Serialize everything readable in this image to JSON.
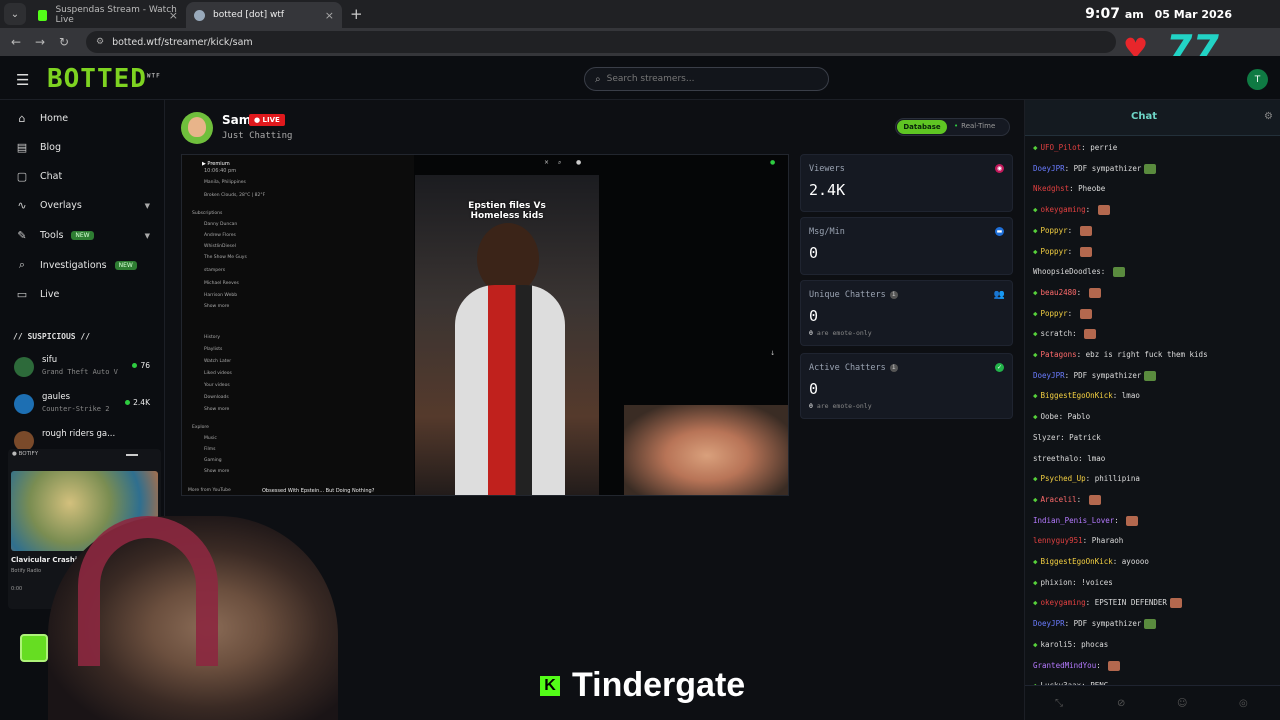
{
  "browser": {
    "tabs": [
      {
        "label": "Suspendas Stream - Watch Live",
        "active": false
      },
      {
        "label": "botted [dot] wtf",
        "active": true
      }
    ],
    "url": "botted.wtf/streamer/kick/sam",
    "clock_time": "9:07",
    "clock_ampm": "am",
    "clock_date": "05 Mar 2026",
    "overlay_number": "77"
  },
  "header": {
    "logo": "BOTTED",
    "logo_sup": "WTF",
    "search_placeholder": "Search streamers...",
    "user_initial": "T"
  },
  "sidebar": {
    "items": [
      {
        "label": "Home",
        "icon": "home-icon"
      },
      {
        "label": "Blog",
        "icon": "blog-icon"
      },
      {
        "label": "Chat",
        "icon": "chat-icon"
      },
      {
        "label": "Overlays",
        "icon": "overlays-icon"
      },
      {
        "label": "Tools",
        "icon": "tools-icon",
        "badge": "NEW"
      },
      {
        "label": "Investigations",
        "icon": "investigations-icon",
        "badge": "NEW"
      },
      {
        "label": "Live",
        "icon": "live-icon"
      }
    ],
    "suspicious_title": "// SUSPICIOUS //",
    "suspicious": [
      {
        "name": "sifu",
        "game": "Grand Theft Auto V",
        "viewers": "76"
      },
      {
        "name": "gaules",
        "game": "Counter-Strike 2",
        "viewers": "2.4K"
      },
      {
        "name": "rough riders ga...",
        "game": "",
        "viewers": ""
      }
    ]
  },
  "botify": {
    "title": "BOTIFY",
    "song": "Clavicular Crashin'",
    "artist": "Botify Radio",
    "time": "0:00"
  },
  "streamer": {
    "name": "Sam",
    "live_label": "LIVE",
    "category": "Just Chatting",
    "toggle_on": "Database",
    "toggle_off": "Real-Time"
  },
  "video": {
    "caption": "Epstien files Vs Homeless kids",
    "yt_time": "10:06:40 pm",
    "yt_location": "Manila, Philippines",
    "yt_weather": "Broken Clouds, 28°C | 82°F",
    "yt_footer": "Obsessed With Epstein... But Doing Nothing?",
    "yt_more": "More from YouTube",
    "yt_sidebar": [
      "Subscriptions",
      "Danny Duncan",
      "Andrew Flores",
      "WhistlinDiesel",
      "The Show Me Guys",
      "stampers",
      "Michael Reeves",
      "Harrison Webb",
      "Show more",
      "History",
      "Playlists",
      "Watch Later",
      "Liked videos",
      "Your videos",
      "Downloads",
      "Show more",
      "Explore",
      "Music",
      "Films",
      "Gaming",
      "Show more"
    ]
  },
  "stats": {
    "viewers_label": "Viewers",
    "viewers_value": "2.4K",
    "msgmin_label": "Msg/Min",
    "msgmin_value": "0",
    "unique_label": "Unique Chatters",
    "unique_value": "0",
    "unique_sub_num": "0",
    "unique_sub": "are emote-only",
    "active_label": "Active Chatters",
    "active_value": "0",
    "active_sub_num": "0",
    "active_sub": "are emote-only"
  },
  "overlay_caption": "Tindergate",
  "chat": {
    "title": "Chat",
    "messages": [
      {
        "user": "UFO_Pilot",
        "text": "perrie",
        "color": "#e04040",
        "badge": true
      },
      {
        "user": "DoeyJPR",
        "text": "PDF sympathizer",
        "color": "#6a7cff",
        "badge": false,
        "emote": "green"
      },
      {
        "user": "Nkedghst",
        "text": "Pheobe",
        "color": "#e04040",
        "badge": false
      },
      {
        "user": "okeygaming",
        "text": "",
        "color": "#e04040",
        "badge": true,
        "emote": "red"
      },
      {
        "user": "Poppyr",
        "text": "",
        "color": "#f5d142",
        "badge": true,
        "emote": "red"
      },
      {
        "user": "Poppyr",
        "text": "",
        "color": "#f5d142",
        "badge": true,
        "emote": "red"
      },
      {
        "user": "WhoopsieDoodles",
        "text": "",
        "color": "#d9d9d9",
        "badge": false,
        "emote": "green"
      },
      {
        "user": "beau2480",
        "text": "",
        "color": "#ff6b6b",
        "badge": true,
        "emote": "red"
      },
      {
        "user": "Poppyr",
        "text": "",
        "color": "#f5d142",
        "badge": true,
        "emote": "red"
      },
      {
        "user": "scratch",
        "text": "",
        "color": "#d9d9d9",
        "badge": true,
        "emote": "red"
      },
      {
        "user": "Patagons",
        "text": "ebz is right fuck them kids",
        "color": "#ff6b6b",
        "badge": true
      },
      {
        "user": "DoeyJPR",
        "text": "PDF sympathizer",
        "color": "#6a7cff",
        "badge": false,
        "emote": "green"
      },
      {
        "user": "BiggestEgoOnKick",
        "text": "lmao",
        "color": "#f5d142",
        "badge": true
      },
      {
        "user": "Oobe",
        "text": "Pablo",
        "color": "#d9d9d9",
        "badge": true
      },
      {
        "user": "Slyzer",
        "text": "Patrick",
        "color": "#d9d9d9",
        "badge": false
      },
      {
        "user": "streethalo",
        "text": "lmao",
        "color": "#d9d9d9",
        "badge": false
      },
      {
        "user": "Psyched_Up",
        "text": "phillipina",
        "color": "#f5d142",
        "badge": true
      },
      {
        "user": "Aracelil",
        "text": "",
        "color": "#ff6b6b",
        "badge": true,
        "emote": "red"
      },
      {
        "user": "Indian_Penis_Lover",
        "text": "",
        "color": "#b57aff",
        "badge": false,
        "emote": "red"
      },
      {
        "user": "lennyguy951",
        "text": "Pharaoh",
        "color": "#e04040",
        "badge": false
      },
      {
        "user": "BiggestEgoOnKick",
        "text": "ayoooo",
        "color": "#f5d142",
        "badge": true
      },
      {
        "user": "phixion",
        "text": "!voices",
        "color": "#d9d9d9",
        "badge": true
      },
      {
        "user": "okeygaming",
        "text": "EPSTEIN DEFENDER",
        "color": "#e04040",
        "badge": true,
        "emote": "red"
      },
      {
        "user": "DoeyJPR",
        "text": "PDF sympathizer",
        "color": "#6a7cff",
        "badge": false,
        "emote": "green"
      },
      {
        "user": "karoli5",
        "text": "phocas",
        "color": "#d9d9d9",
        "badge": true
      },
      {
        "user": "GrantedMindYou",
        "text": "",
        "color": "#b57aff",
        "badge": false,
        "emote": "red"
      },
      {
        "user": "Lucky3aax",
        "text": "PENG",
        "color": "#d9d9d9",
        "badge": true
      }
    ]
  }
}
